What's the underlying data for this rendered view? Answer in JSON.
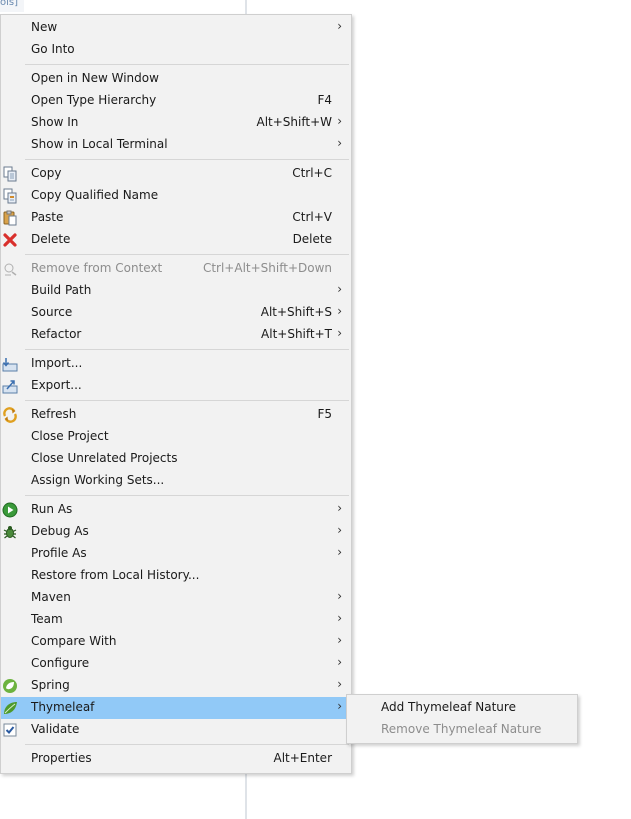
{
  "background": {
    "fragment": "ols]"
  },
  "menu": {
    "new": {
      "label": "New"
    },
    "go_into": {
      "label": "Go Into"
    },
    "open_new_window": {
      "label": "Open in New Window"
    },
    "open_type_hierarchy": {
      "label": "Open Type Hierarchy",
      "shortcut": "F4"
    },
    "show_in": {
      "label": "Show In",
      "shortcut": "Alt+Shift+W"
    },
    "show_in_local_terminal": {
      "label": "Show in Local Terminal"
    },
    "copy": {
      "label": "Copy",
      "shortcut": "Ctrl+C",
      "icon": "copy-icon"
    },
    "copy_qualified_name": {
      "label": "Copy Qualified Name",
      "icon": "copy-qualified-name-icon"
    },
    "paste": {
      "label": "Paste",
      "shortcut": "Ctrl+V",
      "icon": "paste-icon"
    },
    "delete": {
      "label": "Delete",
      "shortcut": "Delete",
      "icon": "delete-icon"
    },
    "remove_from_context": {
      "label": "Remove from Context",
      "shortcut": "Ctrl+Alt+Shift+Down",
      "icon": "remove-context-icon",
      "disabled": true
    },
    "build_path": {
      "label": "Build Path"
    },
    "source": {
      "label": "Source",
      "shortcut": "Alt+Shift+S"
    },
    "refactor": {
      "label": "Refactor",
      "shortcut": "Alt+Shift+T"
    },
    "import": {
      "label": "Import...",
      "icon": "import-icon"
    },
    "export": {
      "label": "Export...",
      "icon": "export-icon"
    },
    "refresh": {
      "label": "Refresh",
      "shortcut": "F5",
      "icon": "refresh-icon"
    },
    "close_project": {
      "label": "Close Project"
    },
    "close_unrelated_projects": {
      "label": "Close Unrelated Projects"
    },
    "assign_working_sets": {
      "label": "Assign Working Sets..."
    },
    "run_as": {
      "label": "Run As",
      "icon": "run-icon"
    },
    "debug_as": {
      "label": "Debug As",
      "icon": "debug-bug-icon"
    },
    "profile_as": {
      "label": "Profile As"
    },
    "restore_local_history": {
      "label": "Restore from Local History..."
    },
    "maven": {
      "label": "Maven"
    },
    "team": {
      "label": "Team"
    },
    "compare_with": {
      "label": "Compare With"
    },
    "configure": {
      "label": "Configure"
    },
    "spring": {
      "label": "Spring",
      "icon": "spring-icon"
    },
    "thymeleaf": {
      "label": "Thymeleaf",
      "icon": "thymeleaf-leaf-icon",
      "selected": true
    },
    "validate": {
      "label": "Validate",
      "icon": "validate-checkbox-icon"
    },
    "properties": {
      "label": "Properties",
      "shortcut": "Alt+Enter"
    },
    "submenu_arrow": "›"
  },
  "thymeleaf_submenu": {
    "add_nature": {
      "label": "Add Thymeleaf Nature"
    },
    "remove_nature": {
      "label": "Remove Thymeleaf Nature",
      "disabled": true
    }
  },
  "colors": {
    "menu_bg": "#f2f2f2",
    "selected_bg": "#91c9f7",
    "disabled_text": "#8d8d8d",
    "separator": "#d6d6d6"
  }
}
